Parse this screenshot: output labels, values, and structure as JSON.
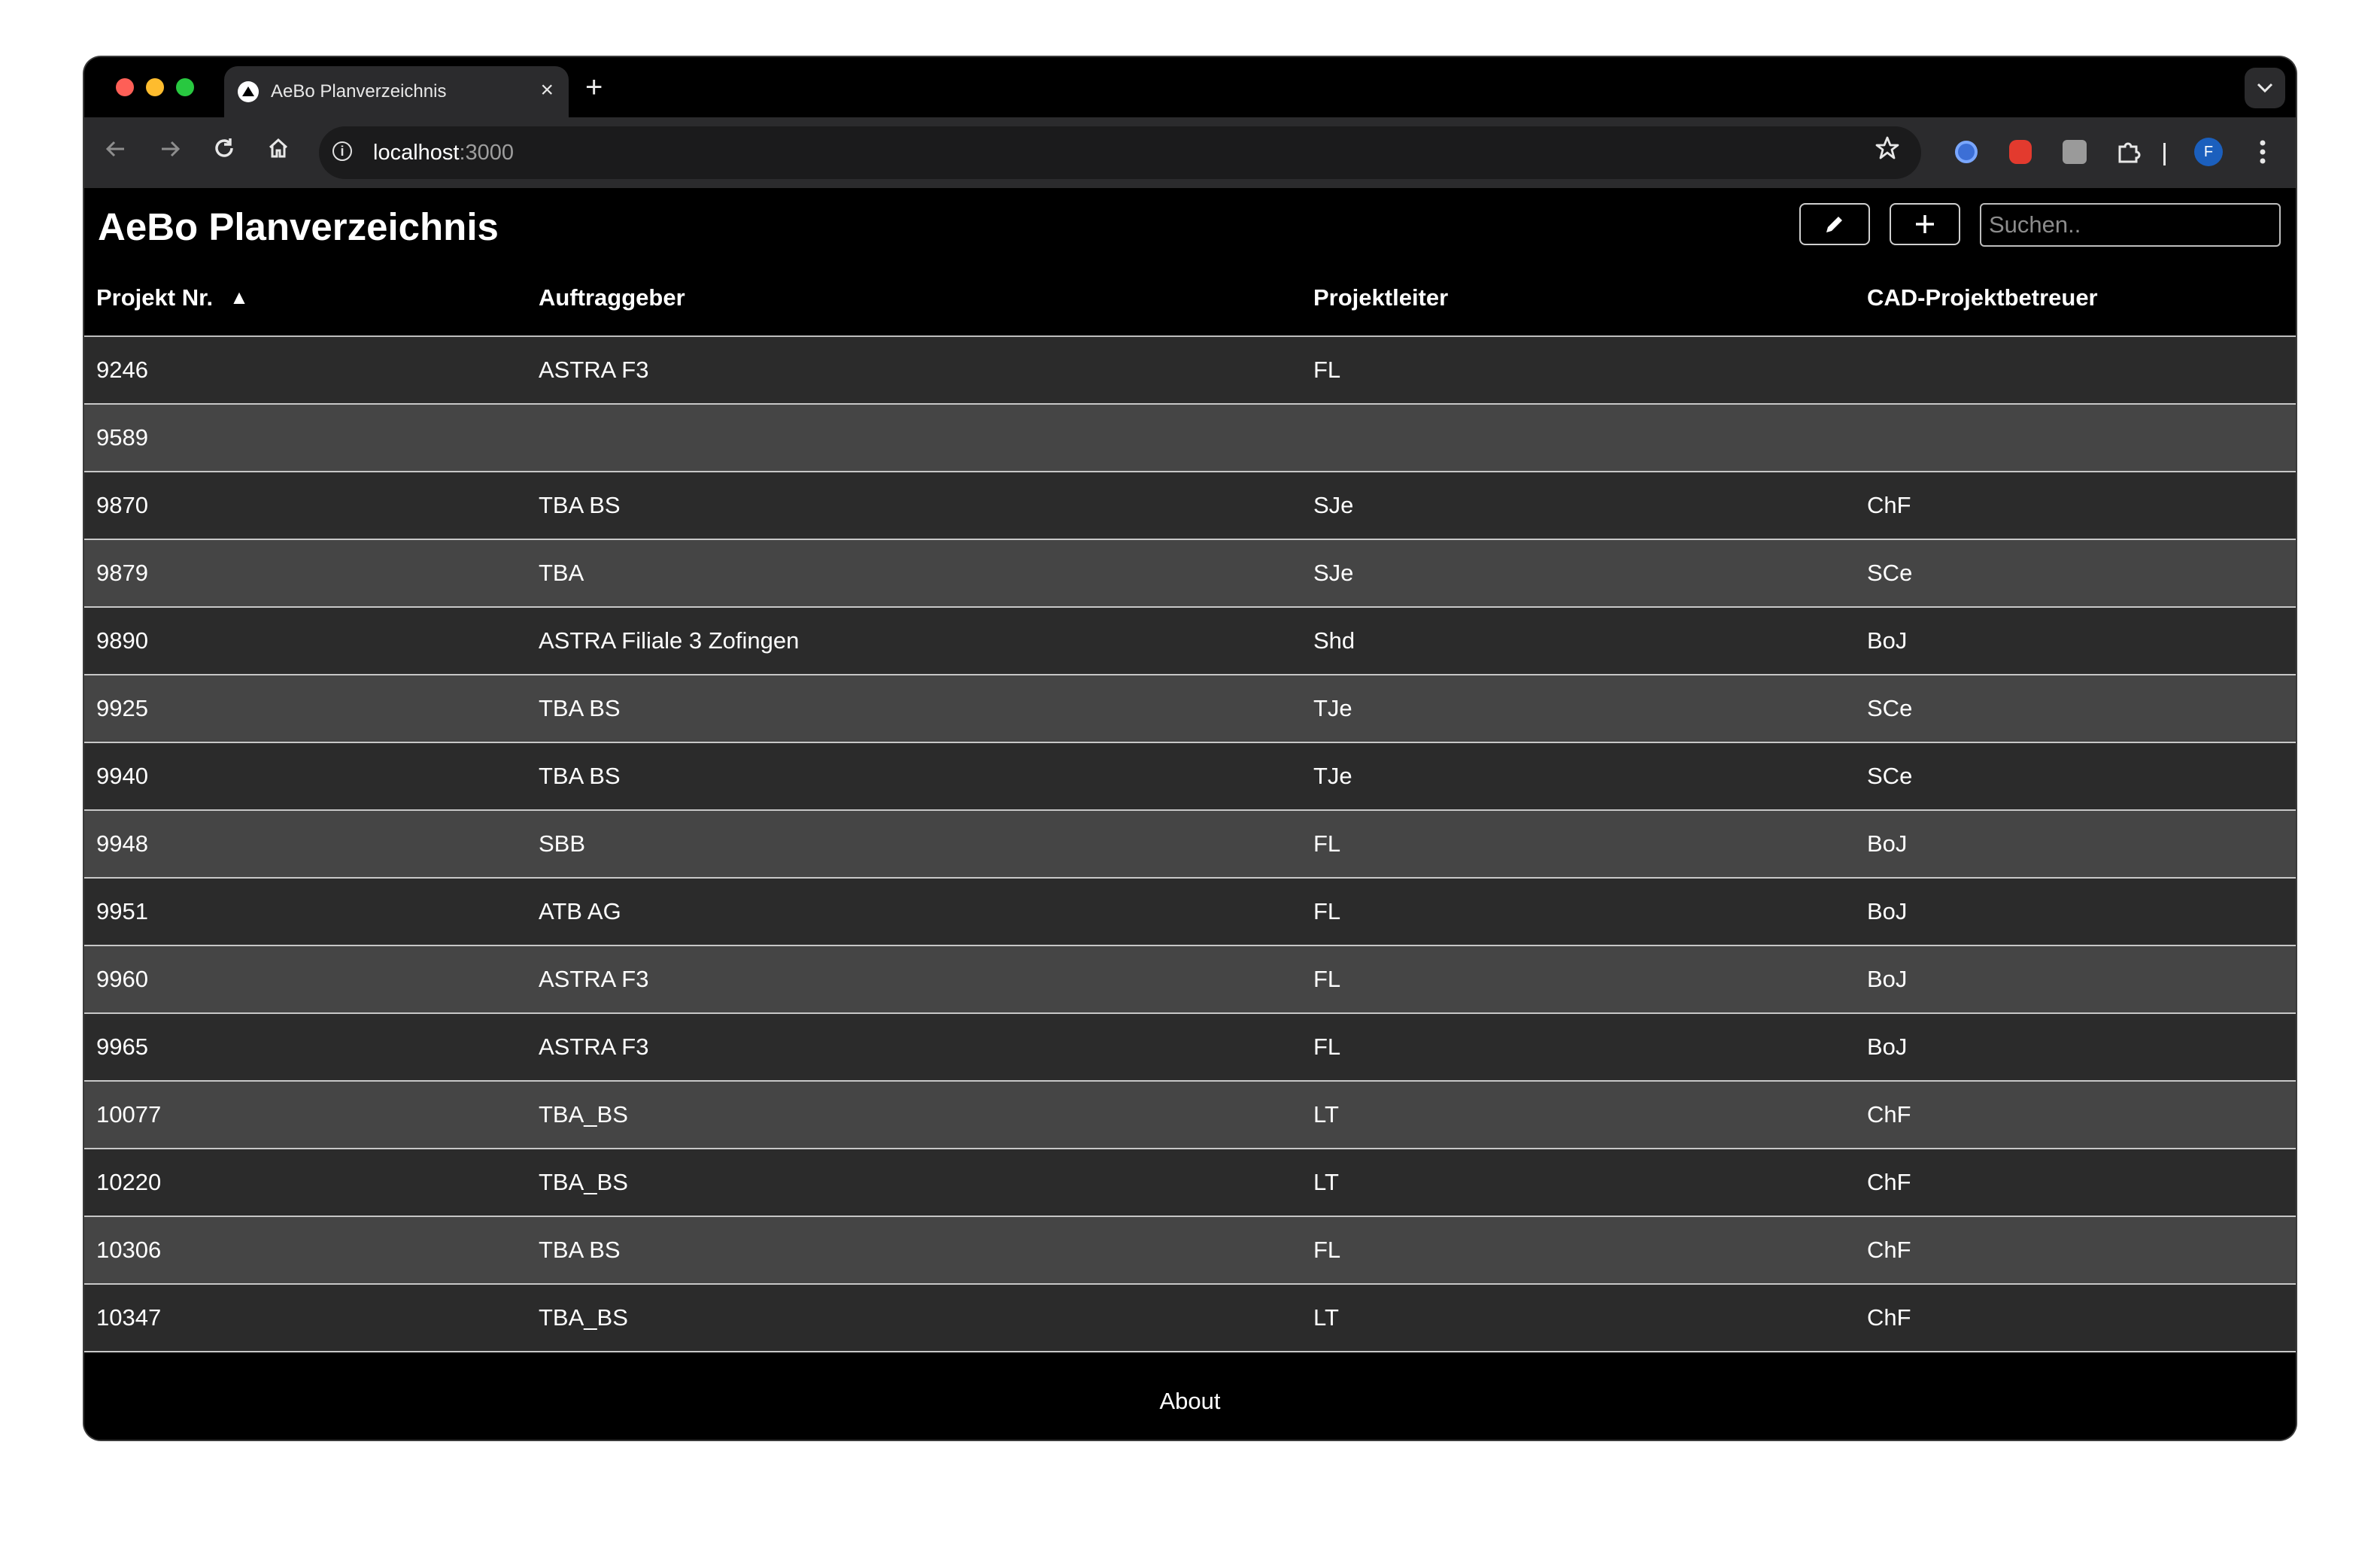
{
  "browser": {
    "tab_title": "AeBo Planverzeichnis",
    "tab_close": "×",
    "new_tab": "+",
    "url_host": "localhost",
    "url_port": ":3000",
    "profile_initial": "F"
  },
  "app": {
    "title": "AeBo Planverzeichnis",
    "search_placeholder": "Suchen..",
    "edit_icon": "pencil-icon",
    "add_icon": "plus-icon"
  },
  "table": {
    "columns": [
      "Projekt Nr.",
      "Auftraggeber",
      "Projektleiter",
      "CAD-Projektbetreuer"
    ],
    "sort_indicator": "▲",
    "rows": [
      [
        "9246",
        "ASTRA F3",
        "FL",
        ""
      ],
      [
        "9589",
        "",
        "",
        ""
      ],
      [
        "9870",
        "TBA BS",
        "SJe",
        "ChF"
      ],
      [
        "9879",
        "TBA",
        "SJe",
        "SCe"
      ],
      [
        "9890",
        "ASTRA Filiale 3 Zofingen",
        "Shd",
        "BoJ"
      ],
      [
        "9925",
        "TBA BS",
        "TJe",
        "SCe"
      ],
      [
        "9940",
        "TBA BS",
        "TJe",
        "SCe"
      ],
      [
        "9948",
        "SBB",
        "FL",
        "BoJ"
      ],
      [
        "9951",
        "ATB AG",
        "FL",
        "BoJ"
      ],
      [
        "9960",
        "ASTRA F3",
        "FL",
        "BoJ"
      ],
      [
        "9965",
        "ASTRA F3",
        "FL",
        "BoJ"
      ],
      [
        "10077",
        "TBA_BS",
        "LT",
        "ChF"
      ],
      [
        "10220",
        "TBA_BS",
        "LT",
        "ChF"
      ],
      [
        "10306",
        "TBA BS",
        "FL",
        "ChF"
      ],
      [
        "10347",
        "TBA_BS",
        "LT",
        "ChF"
      ]
    ]
  },
  "footer": {
    "about": "About"
  }
}
